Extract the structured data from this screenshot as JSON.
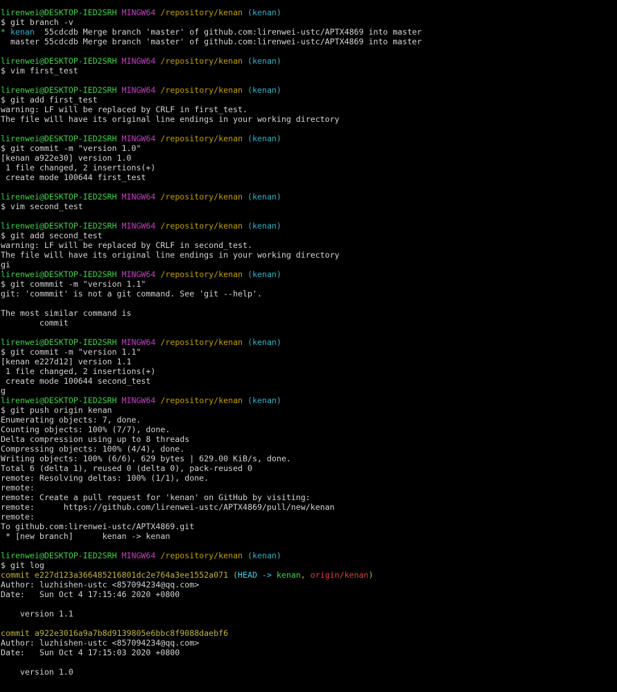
{
  "colors": {
    "background": "#000000",
    "text": "#d4d4d4",
    "user_host": "#3fd44a",
    "mingw": "#c53ec5",
    "path": "#c4a100",
    "branch": "#2cb5c9",
    "commit_hash": "#c4b43a",
    "head_ref": "#3ad8f0",
    "origin_ref": "#e53b3b"
  },
  "prompt": {
    "user_host": "lirenwei@DESKTOP-IED2SRH",
    "system": "MINGW64",
    "path": "/repository/kenan",
    "branch": "(kenan)"
  },
  "lines": [
    {
      "type": "prompt"
    },
    {
      "type": "text",
      "text": "$ git branch -v"
    },
    {
      "type": "segments",
      "segments": [
        {
          "text": "* ",
          "cls": "green"
        },
        {
          "text": "kenan",
          "cls": "branch"
        },
        {
          "text": "  55cdcdb Merge branch 'master' of github.com:lirenwei-ustc/APTX4869 into master"
        }
      ]
    },
    {
      "type": "text",
      "text": "  master 55cdcdb Merge branch 'master' of github.com:lirenwei-ustc/APTX4869 into master"
    },
    {
      "type": "blank"
    },
    {
      "type": "prompt"
    },
    {
      "type": "text",
      "text": "$ vim first_test"
    },
    {
      "type": "blank"
    },
    {
      "type": "prompt"
    },
    {
      "type": "text",
      "text": "$ git add first_test"
    },
    {
      "type": "text",
      "text": "warning: LF will be replaced by CRLF in first_test."
    },
    {
      "type": "text",
      "text": "The file will have its original line endings in your working directory"
    },
    {
      "type": "blank"
    },
    {
      "type": "prompt"
    },
    {
      "type": "text",
      "text": "$ git commit -m \"version 1.0\""
    },
    {
      "type": "text",
      "text": "[kenan a922e30] version 1.0"
    },
    {
      "type": "text",
      "text": " 1 file changed, 2 insertions(+)"
    },
    {
      "type": "text",
      "text": " create mode 100644 first_test"
    },
    {
      "type": "blank"
    },
    {
      "type": "prompt"
    },
    {
      "type": "text",
      "text": "$ vim second_test"
    },
    {
      "type": "blank"
    },
    {
      "type": "prompt"
    },
    {
      "type": "text",
      "text": "$ git add second_test"
    },
    {
      "type": "text",
      "text": "warning: LF will be replaced by CRLF in second_test."
    },
    {
      "type": "text",
      "text": "The file will have its original line endings in your working directory"
    },
    {
      "type": "text",
      "text": "gi"
    },
    {
      "type": "prompt"
    },
    {
      "type": "text",
      "text": "$ git commmit -m \"version 1.1\""
    },
    {
      "type": "text",
      "text": "git: 'commmit' is not a git command. See 'git --help'."
    },
    {
      "type": "blank"
    },
    {
      "type": "text",
      "text": "The most similar command is"
    },
    {
      "type": "text",
      "text": "        commit"
    },
    {
      "type": "blank"
    },
    {
      "type": "prompt"
    },
    {
      "type": "text",
      "text": "$ git commit -m \"version 1.1\""
    },
    {
      "type": "text",
      "text": "[kenan e227d12] version 1.1"
    },
    {
      "type": "text",
      "text": " 1 file changed, 2 insertions(+)"
    },
    {
      "type": "text",
      "text": " create mode 100644 second_test"
    },
    {
      "type": "text",
      "text": "g"
    },
    {
      "type": "prompt"
    },
    {
      "type": "text",
      "text": "$ git push origin kenan"
    },
    {
      "type": "text",
      "text": "Enumerating objects: 7, done."
    },
    {
      "type": "text",
      "text": "Counting objects: 100% (7/7), done."
    },
    {
      "type": "text",
      "text": "Delta compression using up to 8 threads"
    },
    {
      "type": "text",
      "text": "Compressing objects: 100% (4/4), done."
    },
    {
      "type": "text",
      "text": "Writing objects: 100% (6/6), 629 bytes | 629.00 KiB/s, done."
    },
    {
      "type": "text",
      "text": "Total 6 (delta 1), reused 0 (delta 0), pack-reused 0"
    },
    {
      "type": "text",
      "text": "remote: Resolving deltas: 100% (1/1), done."
    },
    {
      "type": "text",
      "text": "remote:"
    },
    {
      "type": "text",
      "text": "remote: Create a pull request for 'kenan' on GitHub by visiting:"
    },
    {
      "type": "text",
      "text": "remote:      https://github.com/lirenwei-ustc/APTX4869/pull/new/kenan"
    },
    {
      "type": "text",
      "text": "remote:"
    },
    {
      "type": "text",
      "text": "To github.com:lirenwei-ustc/APTX4869.git"
    },
    {
      "type": "text",
      "text": " * [new branch]      kenan -> kenan"
    },
    {
      "type": "blank"
    },
    {
      "type": "prompt"
    },
    {
      "type": "text",
      "text": "$ git log"
    },
    {
      "type": "segments",
      "segments": [
        {
          "text": "commit e227d123a366485216801dc2e764a3ee1552a071 (",
          "cls": "commit-hash"
        },
        {
          "text": "HEAD -> ",
          "cls": "head"
        },
        {
          "text": "kenan",
          "cls": "green"
        },
        {
          "text": ", ",
          "cls": "commit-hash"
        },
        {
          "text": "origin/kenan",
          "cls": "red"
        },
        {
          "text": ")",
          "cls": "commit-hash"
        }
      ]
    },
    {
      "type": "text",
      "text": "Author: luzhishen-ustc <857094234@qq.com>"
    },
    {
      "type": "text",
      "text": "Date:   Sun Oct 4 17:15:46 2020 +0800"
    },
    {
      "type": "blank"
    },
    {
      "type": "text",
      "text": "    version 1.1"
    },
    {
      "type": "blank"
    },
    {
      "type": "segments",
      "segments": [
        {
          "text": "commit a922e3016a9a7b8d9139805e6bbc8f9088daebf6",
          "cls": "commit-hash"
        }
      ]
    },
    {
      "type": "text",
      "text": "Author: luzhishen-ustc <857094234@qq.com>"
    },
    {
      "type": "text",
      "text": "Date:   Sun Oct 4 17:15:03 2020 +0800"
    },
    {
      "type": "blank"
    },
    {
      "type": "text",
      "text": "    version 1.0"
    }
  ]
}
